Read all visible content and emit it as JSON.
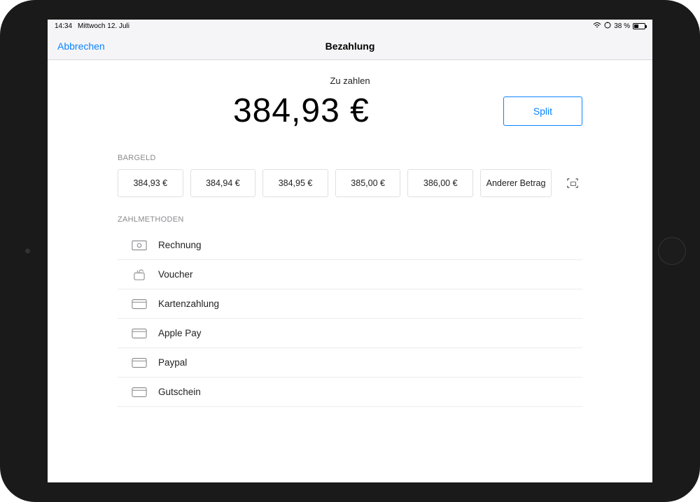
{
  "status": {
    "time": "14:34",
    "date": "Mittwoch 12. Juli",
    "battery_pct": "38 %"
  },
  "nav": {
    "cancel": "Abbrechen",
    "title": "Bezahlung"
  },
  "payment": {
    "subtitle": "Zu zahlen",
    "amount": "384,93 €",
    "split_label": "Split"
  },
  "cash": {
    "label": "BARGELD",
    "options": [
      "384,93 €",
      "384,94 €",
      "384,95 €",
      "385,00 €",
      "386,00 €"
    ],
    "other_label": "Anderer Betrag"
  },
  "methods": {
    "label": "ZAHLMETHODEN",
    "items": [
      {
        "label": "Rechnung",
        "icon": "invoice"
      },
      {
        "label": "Voucher",
        "icon": "voucher"
      },
      {
        "label": "Kartenzahlung",
        "icon": "card"
      },
      {
        "label": "Apple Pay",
        "icon": "card"
      },
      {
        "label": "Paypal",
        "icon": "card"
      },
      {
        "label": "Gutschein",
        "icon": "card"
      }
    ]
  }
}
